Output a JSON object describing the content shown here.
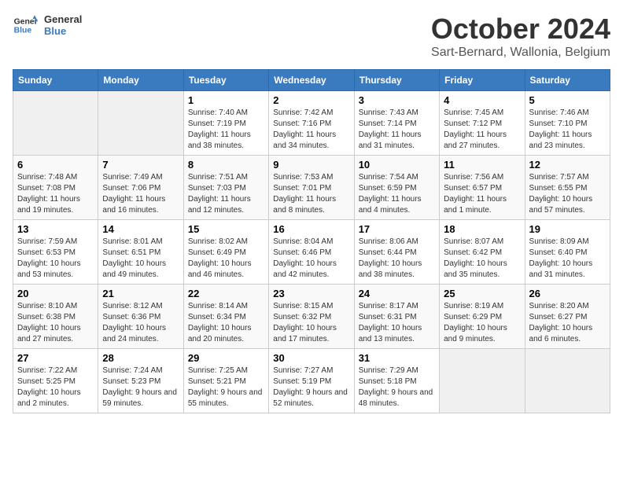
{
  "header": {
    "logo_line1": "General",
    "logo_line2": "Blue",
    "month": "October 2024",
    "location": "Sart-Bernard, Wallonia, Belgium"
  },
  "weekdays": [
    "Sunday",
    "Monday",
    "Tuesday",
    "Wednesday",
    "Thursday",
    "Friday",
    "Saturday"
  ],
  "weeks": [
    [
      {
        "day": "",
        "info": ""
      },
      {
        "day": "",
        "info": ""
      },
      {
        "day": "1",
        "info": "Sunrise: 7:40 AM\nSunset: 7:19 PM\nDaylight: 11 hours and 38 minutes."
      },
      {
        "day": "2",
        "info": "Sunrise: 7:42 AM\nSunset: 7:16 PM\nDaylight: 11 hours and 34 minutes."
      },
      {
        "day": "3",
        "info": "Sunrise: 7:43 AM\nSunset: 7:14 PM\nDaylight: 11 hours and 31 minutes."
      },
      {
        "day": "4",
        "info": "Sunrise: 7:45 AM\nSunset: 7:12 PM\nDaylight: 11 hours and 27 minutes."
      },
      {
        "day": "5",
        "info": "Sunrise: 7:46 AM\nSunset: 7:10 PM\nDaylight: 11 hours and 23 minutes."
      }
    ],
    [
      {
        "day": "6",
        "info": "Sunrise: 7:48 AM\nSunset: 7:08 PM\nDaylight: 11 hours and 19 minutes."
      },
      {
        "day": "7",
        "info": "Sunrise: 7:49 AM\nSunset: 7:06 PM\nDaylight: 11 hours and 16 minutes."
      },
      {
        "day": "8",
        "info": "Sunrise: 7:51 AM\nSunset: 7:03 PM\nDaylight: 11 hours and 12 minutes."
      },
      {
        "day": "9",
        "info": "Sunrise: 7:53 AM\nSunset: 7:01 PM\nDaylight: 11 hours and 8 minutes."
      },
      {
        "day": "10",
        "info": "Sunrise: 7:54 AM\nSunset: 6:59 PM\nDaylight: 11 hours and 4 minutes."
      },
      {
        "day": "11",
        "info": "Sunrise: 7:56 AM\nSunset: 6:57 PM\nDaylight: 11 hours and 1 minute."
      },
      {
        "day": "12",
        "info": "Sunrise: 7:57 AM\nSunset: 6:55 PM\nDaylight: 10 hours and 57 minutes."
      }
    ],
    [
      {
        "day": "13",
        "info": "Sunrise: 7:59 AM\nSunset: 6:53 PM\nDaylight: 10 hours and 53 minutes."
      },
      {
        "day": "14",
        "info": "Sunrise: 8:01 AM\nSunset: 6:51 PM\nDaylight: 10 hours and 49 minutes."
      },
      {
        "day": "15",
        "info": "Sunrise: 8:02 AM\nSunset: 6:49 PM\nDaylight: 10 hours and 46 minutes."
      },
      {
        "day": "16",
        "info": "Sunrise: 8:04 AM\nSunset: 6:46 PM\nDaylight: 10 hours and 42 minutes."
      },
      {
        "day": "17",
        "info": "Sunrise: 8:06 AM\nSunset: 6:44 PM\nDaylight: 10 hours and 38 minutes."
      },
      {
        "day": "18",
        "info": "Sunrise: 8:07 AM\nSunset: 6:42 PM\nDaylight: 10 hours and 35 minutes."
      },
      {
        "day": "19",
        "info": "Sunrise: 8:09 AM\nSunset: 6:40 PM\nDaylight: 10 hours and 31 minutes."
      }
    ],
    [
      {
        "day": "20",
        "info": "Sunrise: 8:10 AM\nSunset: 6:38 PM\nDaylight: 10 hours and 27 minutes."
      },
      {
        "day": "21",
        "info": "Sunrise: 8:12 AM\nSunset: 6:36 PM\nDaylight: 10 hours and 24 minutes."
      },
      {
        "day": "22",
        "info": "Sunrise: 8:14 AM\nSunset: 6:34 PM\nDaylight: 10 hours and 20 minutes."
      },
      {
        "day": "23",
        "info": "Sunrise: 8:15 AM\nSunset: 6:32 PM\nDaylight: 10 hours and 17 minutes."
      },
      {
        "day": "24",
        "info": "Sunrise: 8:17 AM\nSunset: 6:31 PM\nDaylight: 10 hours and 13 minutes."
      },
      {
        "day": "25",
        "info": "Sunrise: 8:19 AM\nSunset: 6:29 PM\nDaylight: 10 hours and 9 minutes."
      },
      {
        "day": "26",
        "info": "Sunrise: 8:20 AM\nSunset: 6:27 PM\nDaylight: 10 hours and 6 minutes."
      }
    ],
    [
      {
        "day": "27",
        "info": "Sunrise: 7:22 AM\nSunset: 5:25 PM\nDaylight: 10 hours and 2 minutes."
      },
      {
        "day": "28",
        "info": "Sunrise: 7:24 AM\nSunset: 5:23 PM\nDaylight: 9 hours and 59 minutes."
      },
      {
        "day": "29",
        "info": "Sunrise: 7:25 AM\nSunset: 5:21 PM\nDaylight: 9 hours and 55 minutes."
      },
      {
        "day": "30",
        "info": "Sunrise: 7:27 AM\nSunset: 5:19 PM\nDaylight: 9 hours and 52 minutes."
      },
      {
        "day": "31",
        "info": "Sunrise: 7:29 AM\nSunset: 5:18 PM\nDaylight: 9 hours and 48 minutes."
      },
      {
        "day": "",
        "info": ""
      },
      {
        "day": "",
        "info": ""
      }
    ]
  ]
}
